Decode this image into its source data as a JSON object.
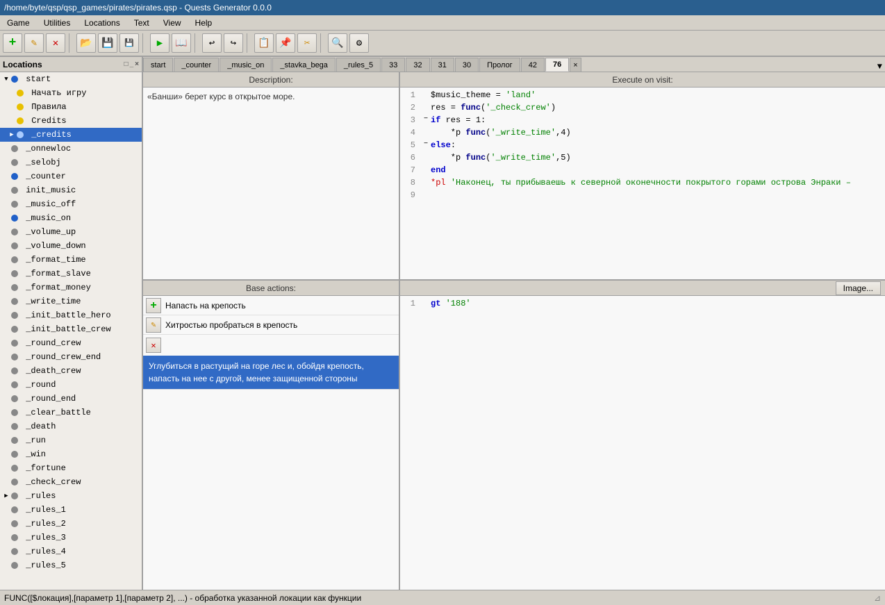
{
  "titlebar": {
    "text": "/home/byte/qsp/qsp_games/pirates/pirates.qsp - Quests Generator 0.0.0"
  },
  "menubar": {
    "items": [
      "Game",
      "Utilities",
      "Locations",
      "Text",
      "View",
      "Help"
    ]
  },
  "toolbar": {
    "buttons": [
      {
        "name": "new-icon",
        "icon": "➕",
        "color": "#00aa00"
      },
      {
        "name": "edit-icon",
        "icon": "✏️"
      },
      {
        "name": "delete-icon",
        "icon": "❌"
      },
      {
        "name": "sep1",
        "type": "sep"
      },
      {
        "name": "open-icon",
        "icon": "📂"
      },
      {
        "name": "save-icon",
        "icon": "💾"
      },
      {
        "name": "saveas-icon",
        "icon": "💾"
      },
      {
        "name": "sep2",
        "type": "sep"
      },
      {
        "name": "run-icon",
        "icon": "▶"
      },
      {
        "name": "help-icon",
        "icon": "📖"
      },
      {
        "name": "sep3",
        "type": "sep"
      },
      {
        "name": "undo-icon",
        "icon": "↩"
      },
      {
        "name": "redo-icon",
        "icon": "↪"
      },
      {
        "name": "sep4",
        "type": "sep"
      },
      {
        "name": "copy-icon",
        "icon": "📋"
      },
      {
        "name": "paste-icon",
        "icon": "📌"
      },
      {
        "name": "cut-icon",
        "icon": "✂"
      },
      {
        "name": "sep5",
        "type": "sep"
      },
      {
        "name": "search-icon",
        "icon": "🔍"
      },
      {
        "name": "settings-icon",
        "icon": "⚙"
      }
    ]
  },
  "sidebar": {
    "title": "Locations",
    "items": [
      {
        "label": "start",
        "type": "folder",
        "expanded": true,
        "level": 0,
        "dot": "none",
        "arrow": "▼"
      },
      {
        "label": "Начать игру",
        "type": "item",
        "level": 1,
        "dot": "yellow"
      },
      {
        "label": "Правила",
        "type": "item",
        "level": 1,
        "dot": "yellow"
      },
      {
        "label": "Credits",
        "type": "item",
        "level": 1,
        "dot": "yellow"
      },
      {
        "label": "_credits",
        "type": "item",
        "level": 0,
        "dot": "blue",
        "selected": true
      },
      {
        "label": "_onnewloc",
        "type": "item",
        "level": 0,
        "dot": "gray"
      },
      {
        "label": "_selobj",
        "type": "item",
        "level": 0,
        "dot": "gray"
      },
      {
        "label": "_counter",
        "type": "item",
        "level": 0,
        "dot": "blue"
      },
      {
        "label": "init_music",
        "type": "item",
        "level": 0,
        "dot": "gray"
      },
      {
        "label": "_music_off",
        "type": "item",
        "level": 0,
        "dot": "gray"
      },
      {
        "label": "_music_on",
        "type": "item",
        "level": 0,
        "dot": "blue"
      },
      {
        "label": "_volume_up",
        "type": "item",
        "level": 0,
        "dot": "gray"
      },
      {
        "label": "_volume_down",
        "type": "item",
        "level": 0,
        "dot": "gray"
      },
      {
        "label": "_format_time",
        "type": "item",
        "level": 0,
        "dot": "gray"
      },
      {
        "label": "_format_slave",
        "type": "item",
        "level": 0,
        "dot": "gray"
      },
      {
        "label": "_format_money",
        "type": "item",
        "level": 0,
        "dot": "gray"
      },
      {
        "label": "_write_time",
        "type": "item",
        "level": 0,
        "dot": "gray"
      },
      {
        "label": "_init_battle_hero",
        "type": "item",
        "level": 0,
        "dot": "gray"
      },
      {
        "label": "_init_battle_crew",
        "type": "item",
        "level": 0,
        "dot": "gray"
      },
      {
        "label": "_round_crew",
        "type": "item",
        "level": 0,
        "dot": "gray"
      },
      {
        "label": "_round_crew_end",
        "type": "item",
        "level": 0,
        "dot": "gray"
      },
      {
        "label": "_death_crew",
        "type": "item",
        "level": 0,
        "dot": "gray"
      },
      {
        "label": "_round",
        "type": "item",
        "level": 0,
        "dot": "gray"
      },
      {
        "label": "_round_end",
        "type": "item",
        "level": 0,
        "dot": "gray"
      },
      {
        "label": "_clear_battle",
        "type": "item",
        "level": 0,
        "dot": "gray"
      },
      {
        "label": "_death",
        "type": "item",
        "level": 0,
        "dot": "gray"
      },
      {
        "label": "_run",
        "type": "item",
        "level": 0,
        "dot": "gray"
      },
      {
        "label": "_win",
        "type": "item",
        "level": 0,
        "dot": "gray"
      },
      {
        "label": "_fortune",
        "type": "item",
        "level": 0,
        "dot": "gray"
      },
      {
        "label": "_check_crew",
        "type": "item",
        "level": 0,
        "dot": "gray"
      },
      {
        "label": "_rules",
        "type": "item",
        "level": 0,
        "dot": "gray",
        "has_arrow": true,
        "arrow": "▶"
      },
      {
        "label": "_rules_1",
        "type": "item",
        "level": 0,
        "dot": "gray"
      },
      {
        "label": "_rules_2",
        "type": "item",
        "level": 0,
        "dot": "gray"
      },
      {
        "label": "_rules_3",
        "type": "item",
        "level": 0,
        "dot": "gray"
      },
      {
        "label": "_rules_4",
        "type": "item",
        "level": 0,
        "dot": "gray"
      },
      {
        "label": "_rules_5",
        "type": "item",
        "level": 0,
        "dot": "gray"
      }
    ]
  },
  "tabs": {
    "items": [
      {
        "label": "start",
        "active": false
      },
      {
        "label": "_counter",
        "active": false
      },
      {
        "label": "_music_on",
        "active": false
      },
      {
        "label": "_stavka_bega",
        "active": false
      },
      {
        "label": "_rules_5",
        "active": false
      },
      {
        "label": "33",
        "active": false
      },
      {
        "label": "32",
        "active": false
      },
      {
        "label": "31",
        "active": false
      },
      {
        "label": "30",
        "active": false
      },
      {
        "label": "Пролог",
        "active": false
      },
      {
        "label": "42",
        "active": false
      },
      {
        "label": "76",
        "active": true
      }
    ]
  },
  "description": {
    "header": "Description:",
    "content": "«Банши» берет курс в открытое море."
  },
  "execute": {
    "header": "Execute on visit:",
    "lines": [
      {
        "num": 1,
        "fold": "",
        "html": "<span class='kw-black'>$music_theme = </span><span class='kw-string'>'land'</span>"
      },
      {
        "num": 2,
        "fold": "",
        "html": "<span class='kw-black'>res = </span><span class='kw-func'>func</span><span class='kw-black'>(</span><span class='kw-string'>'_check_crew'</span><span class='kw-black'>)</span>"
      },
      {
        "num": 3,
        "fold": "−",
        "html": "<span class='kw-blue'>if</span><span class='kw-black'> res = 1:</span>"
      },
      {
        "num": 4,
        "fold": "",
        "html": "<span class='kw-black'>    *p </span><span class='kw-func'>func</span><span class='kw-black'>(</span><span class='kw-string'>'_write_time'</span><span class='kw-black'>,4)</span>"
      },
      {
        "num": 5,
        "fold": "",
        "html": "<span class='kw-blue'>else</span><span class='kw-black'>:</span>"
      },
      {
        "num": 6,
        "fold": "−",
        "html": "<span class='kw-black'>    *p </span><span class='kw-func'>func</span><span class='kw-black'>(</span><span class='kw-string'>'_write_time'</span><span class='kw-black'>,5)</span>"
      },
      {
        "num": 7,
        "fold": "",
        "html": "<span class='kw-blue'>end</span>"
      },
      {
        "num": 8,
        "fold": "",
        "html": "<span class='kw-red'>*pl</span><span class='kw-black'> </span><span class='kw-string'>'Наконец, ты прибываешь к северной оконечности покрытого горами острова Энраки –</span>"
      },
      {
        "num": 9,
        "fold": "",
        "html": ""
      }
    ]
  },
  "base_actions": {
    "header": "Base actions:",
    "actions": [
      {
        "icon": "➕",
        "icon_color": "green",
        "text": "Напасть на крепость",
        "selected": false
      },
      {
        "icon": "✏️",
        "text": "Хитростью пробраться в крепость",
        "selected": false
      },
      {
        "icon": "❌",
        "text": "Углубиться в растущий на горе лес и, обойдя крепость, напасть на нее с другой, менее защищенной стороны",
        "selected": true
      }
    ],
    "code_lines": [
      {
        "num": 1,
        "html": "<span class='kw-blue'>gt</span><span class='kw-black'> </span><span class='kw-string'>'188'</span>"
      }
    ],
    "image_btn": "Image..."
  },
  "statusbar": {
    "text": "FUNC([$локация],[параметр 1],[параметр 2], ...) - обработка указанной локации как функции"
  }
}
